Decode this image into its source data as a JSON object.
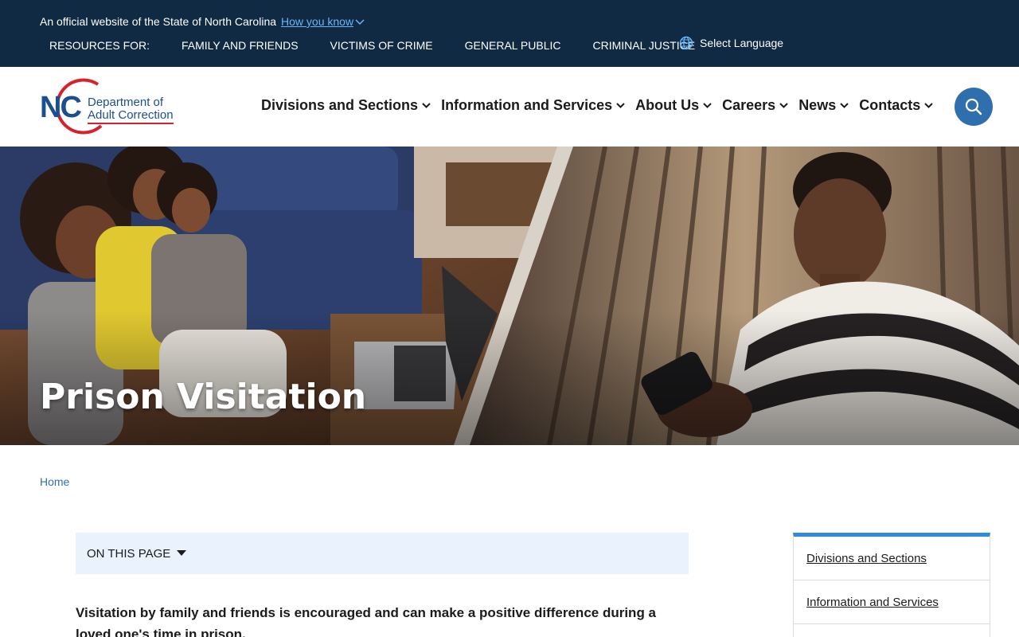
{
  "official_banner": {
    "text": "An official website of the State of North Carolina",
    "how_you_know": "How you know"
  },
  "resources": {
    "label": "RESOURCES FOR:",
    "links": [
      "FAMILY AND FRIENDS",
      "VICTIMS OF CRIME",
      "GENERAL PUBLIC",
      "CRIMINAL JUSTICE"
    ]
  },
  "language": {
    "label": "Select Language",
    "icon": "globe-icon"
  },
  "logo": {
    "abbr": "NC",
    "line1": "Department of",
    "line2": "Adult Correction"
  },
  "main_nav": [
    "Divisions and Sections",
    "Information and Services",
    "About Us",
    "Careers",
    "News",
    "Contacts"
  ],
  "search": {
    "icon": "search-icon"
  },
  "hero": {
    "title": "Prison Visitation"
  },
  "breadcrumb": {
    "home": "Home"
  },
  "on_this_page": {
    "label": "ON THIS PAGE"
  },
  "intro": "Visitation by family and friends is encouraged and can make a positive difference during a loved one's time in prison.",
  "side_nav": [
    "Divisions and Sections",
    "Information and Services"
  ],
  "colors": {
    "top_banner": "#0f2a42",
    "brand_blue": "#1c4f8f",
    "accent_blue": "#2f6fad",
    "light_panel": "#eaf3fd",
    "logo_red": "#d6222a"
  }
}
